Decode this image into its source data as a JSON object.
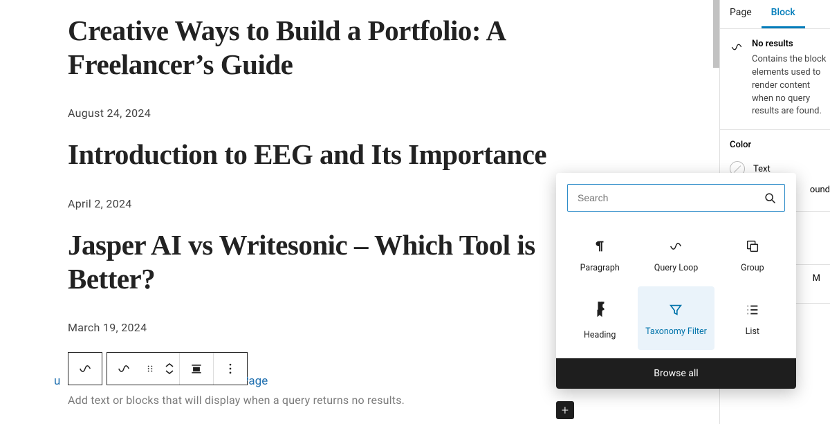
{
  "posts": [
    {
      "title": "Creative Ways to Build a Portfolio: A Freelancer’s Guide",
      "date": "August 24, 2024"
    },
    {
      "title": "Introduction to EEG and Its Importance",
      "date": "April 2, 2024"
    },
    {
      "title": "Jasper AI vs Writesonic – Which Tool is Better?",
      "date": "March 19, 2024"
    }
  ],
  "pagination": {
    "left_fragment": "u",
    "right_fragment": "t Page"
  },
  "no_results_placeholder": "Add text or blocks that will display when a query returns no results.",
  "sidebar": {
    "tabs": {
      "page": "Page",
      "block": "Block"
    },
    "block_panel": {
      "title": "No results",
      "description": "Contains the block elements used to render content when no query results are found."
    },
    "color_section": {
      "label": "Color",
      "text": "Text",
      "background_fragment": "ound"
    },
    "dimensions_fragment": "M"
  },
  "inserter": {
    "search_placeholder": "Search",
    "blocks": [
      {
        "key": "paragraph",
        "label": "Paragraph"
      },
      {
        "key": "query-loop",
        "label": "Query Loop"
      },
      {
        "key": "group",
        "label": "Group"
      },
      {
        "key": "heading",
        "label": "Heading"
      },
      {
        "key": "taxonomy-filter",
        "label": "Taxonomy Filter"
      },
      {
        "key": "list",
        "label": "List"
      }
    ],
    "browse_all": "Browse all"
  }
}
